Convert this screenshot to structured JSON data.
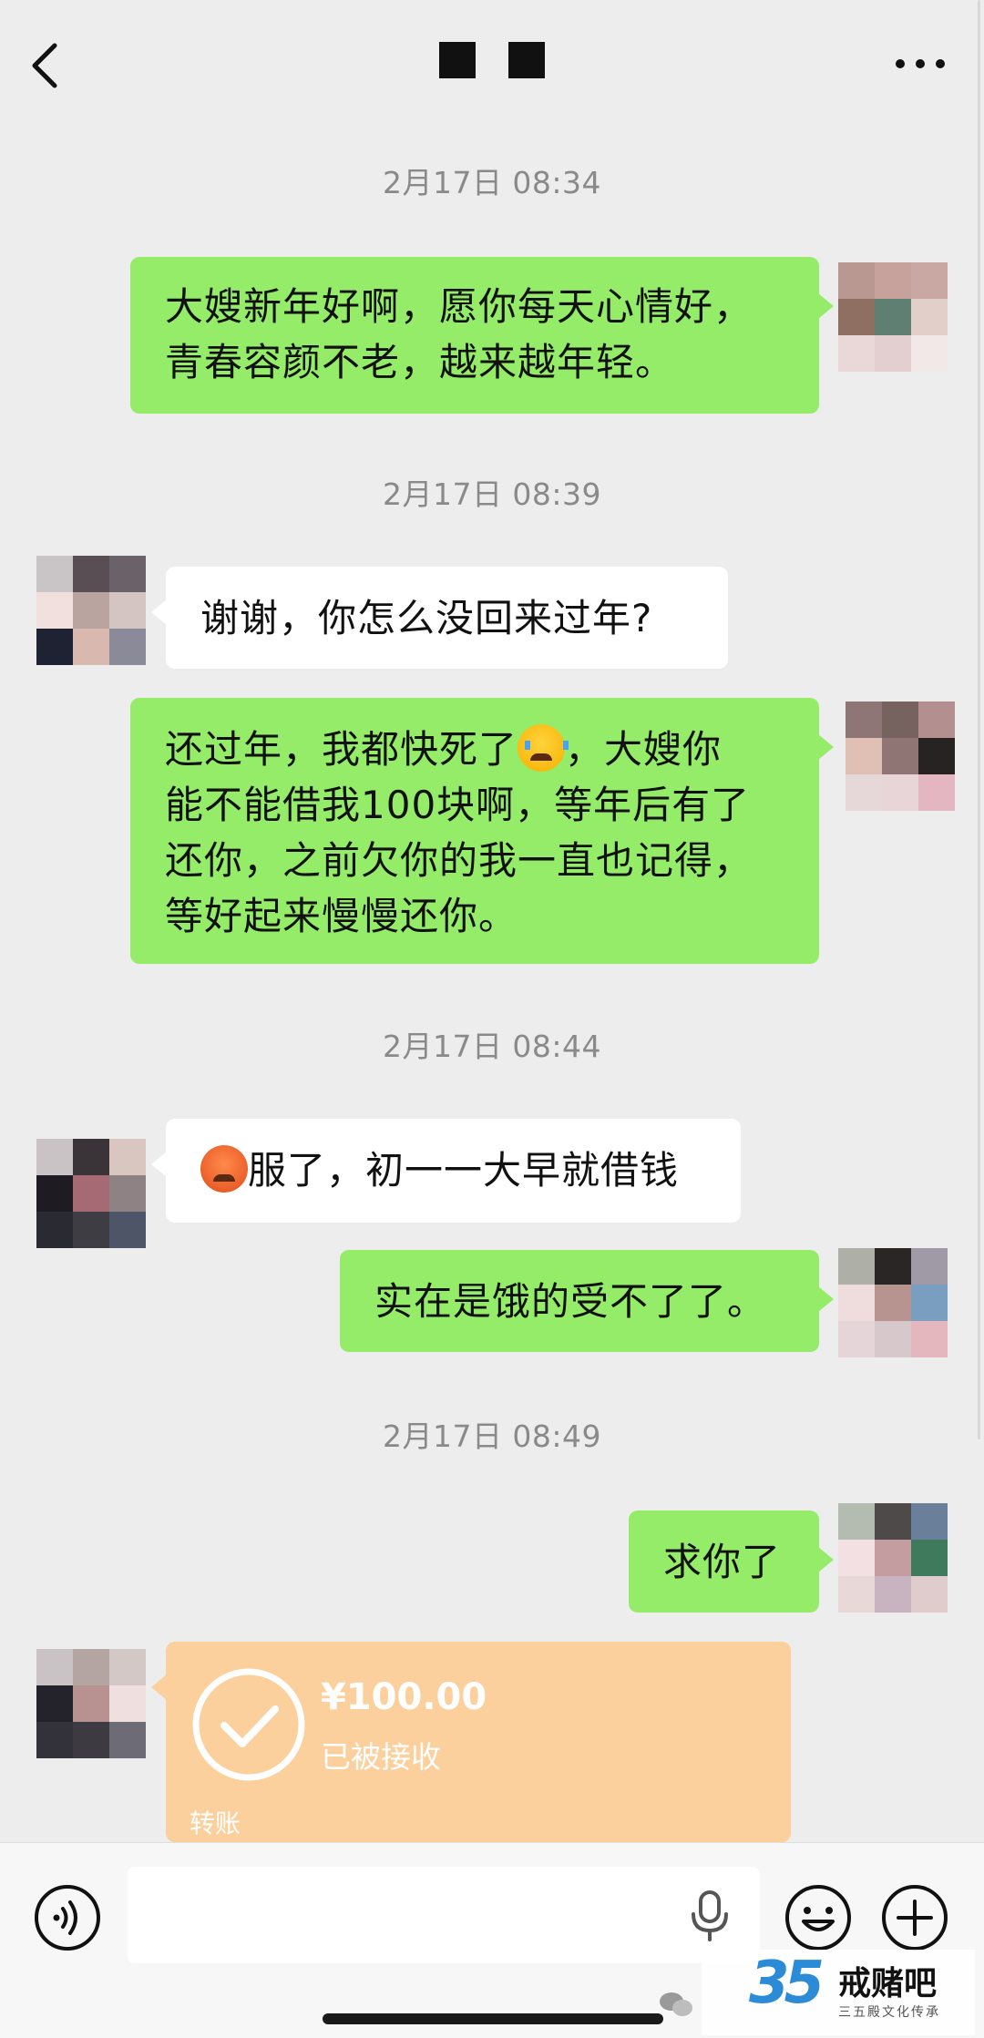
{
  "header": {
    "title": "■ ■",
    "back_icon": "chevron-left-icon",
    "more_icon": "more-dots-icon"
  },
  "messages": [
    {
      "type": "timestamp",
      "text": "2月17日 08:34"
    },
    {
      "type": "text",
      "from": "me",
      "lines": [
        "大嫂新年好啊，愿你每天心情好，",
        "青春容颜不老，越来越年轻。"
      ]
    },
    {
      "type": "timestamp",
      "text": "2月17日 08:39"
    },
    {
      "type": "text",
      "from": "them",
      "lines": [
        "谢谢，你怎么没回来过年?"
      ]
    },
    {
      "type": "text",
      "from": "me",
      "line1_before": "还过年，我都快死了",
      "line1_emoji": "loudly-crying-emoji",
      "line1_after": "，大嫂你",
      "lines_rest": [
        "能不能借我100块啊，等年后有了",
        "还你，之前欠你的我一直也记得，",
        "等好起来慢慢还你。"
      ]
    },
    {
      "type": "timestamp",
      "text": "2月17日 08:44"
    },
    {
      "type": "text",
      "from": "them",
      "emoji": "frustrated-face-emoji",
      "text": "服了，初一一大早就借钱"
    },
    {
      "type": "text",
      "from": "me",
      "lines": [
        "实在是饿的受不了了。"
      ]
    },
    {
      "type": "timestamp",
      "text": "2月17日 08:49"
    },
    {
      "type": "text",
      "from": "me",
      "lines": [
        "求你了"
      ]
    },
    {
      "type": "transfer",
      "from": "them",
      "amount": "¥100.00",
      "status": "已被接收",
      "label": "转账"
    }
  ],
  "input_bar": {
    "voice_icon": "voice-icon",
    "text_value": "",
    "mic_icon": "microphone-icon",
    "emoji_icon": "smiley-icon",
    "plus_icon": "plus-icon"
  },
  "colors": {
    "background": "#ededed",
    "my_bubble": "#95ec69",
    "their_bubble": "#ffffff",
    "transfer_card": "#fcd09d",
    "timestamp_text": "#8a8a8a"
  },
  "watermark": {
    "logo_number": "35",
    "name": "戒赌吧",
    "subtitle": "三五殿文化传承"
  }
}
